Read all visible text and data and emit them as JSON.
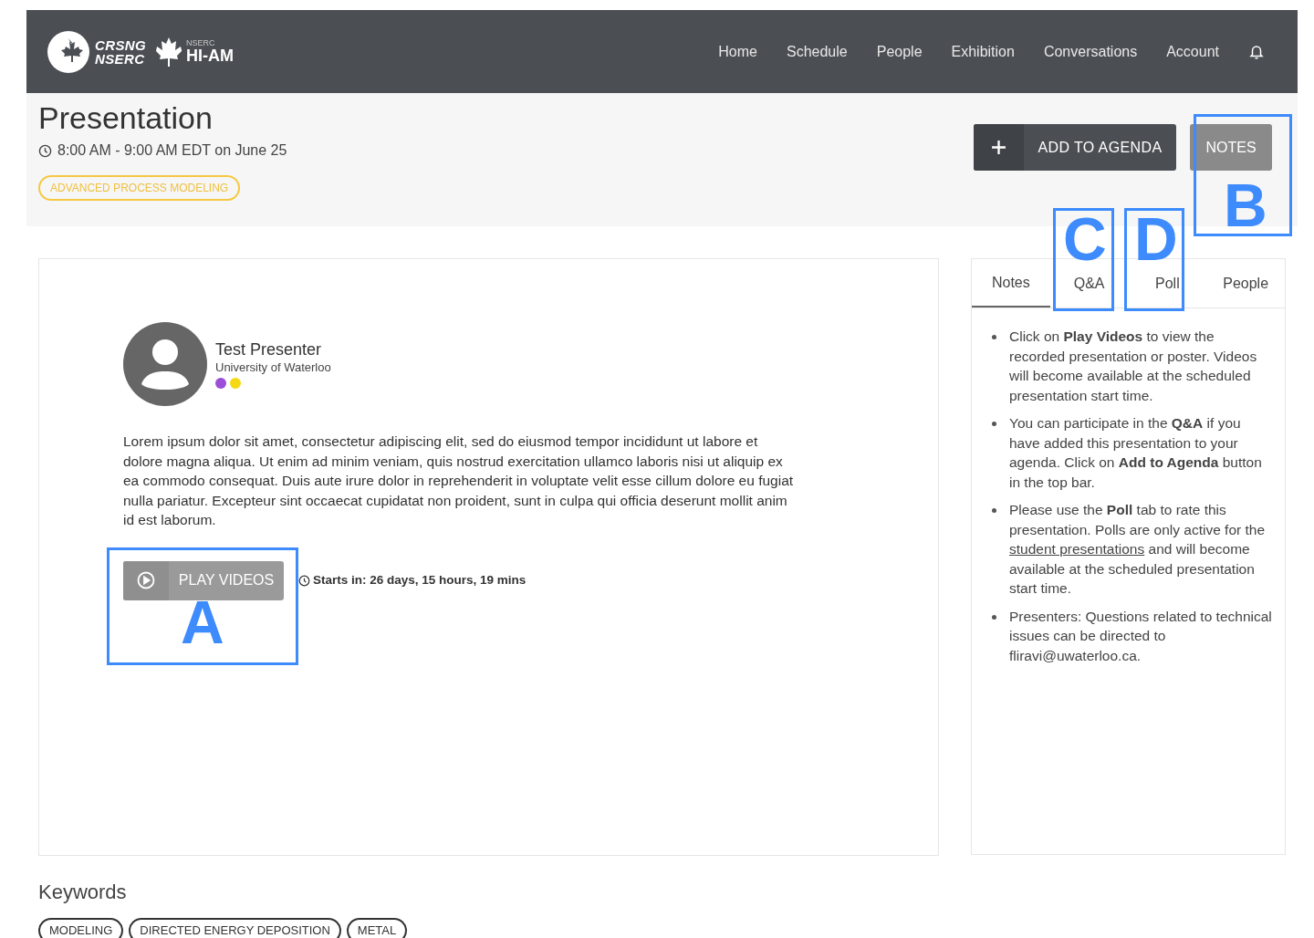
{
  "logo": {
    "org_top": "CRSNG",
    "org_bottom": "NSERC",
    "small": "NSERC",
    "name": "HI-AM"
  },
  "nav": [
    {
      "label": "Home"
    },
    {
      "label": "Schedule"
    },
    {
      "label": "People"
    },
    {
      "label": "Exhibition"
    },
    {
      "label": "Conversations"
    },
    {
      "label": "Account"
    }
  ],
  "page": {
    "title": "Presentation",
    "time": "8:00 AM - 9:00 AM EDT on June 25",
    "topic": "ADVANCED PROCESS MODELING",
    "add_button": "ADD TO AGENDA",
    "notes_button": "NOTES"
  },
  "presenter": {
    "name": "Test Presenter",
    "affiliation": "University of Waterloo",
    "dots": [
      {
        "color": "#9b4fd9"
      },
      {
        "color": "#f5d915"
      }
    ]
  },
  "description": "Lorem ipsum dolor sit amet, consectetur adipiscing elit, sed do eiusmod tempor incididunt ut labore et dolore magna aliqua. Ut enim ad minim veniam, quis nostrud exercitation ullamco laboris nisi ut aliquip ex ea commodo consequat. Duis aute irure dolor in reprehenderit in voluptate velit esse cillum dolore eu fugiat nulla pariatur. Excepteur sint occaecat cupidatat non proident, sunt in culpa qui officia deserunt mollit anim id est laborum.",
  "play_button": {
    "label": "PLAY VIDEOS",
    "disabled": true
  },
  "countdown": "Starts in: 26 days, 15 hours, 19 mins",
  "tabs": [
    {
      "label": "Notes",
      "selected": true
    },
    {
      "label": "Q&A",
      "selected": false
    },
    {
      "label": "Poll",
      "selected": false
    },
    {
      "label": "People",
      "selected": false
    }
  ],
  "notes": [
    {
      "parts": [
        {
          "kind": "text",
          "text": "Click on **Play Videos** to view the recorded presentation or poster. Videos will become available at the scheduled presentation start time."
        }
      ]
    },
    {
      "parts": [
        {
          "kind": "text",
          "text": "You can participate in the **Q&A** if you have added this presentation to your agenda. Click on **Add to Agenda** button in the top bar."
        }
      ]
    },
    {
      "parts": [
        {
          "kind": "text",
          "text": "Please use the **Poll** tab to rate this presentation. Polls are only active for the "
        },
        {
          "kind": "link",
          "text": "student presentations"
        },
        {
          "kind": "text",
          "text": " and will become available at the scheduled presentation start time."
        }
      ]
    },
    {
      "parts": [
        {
          "kind": "text",
          "text": "Presenters: Questions related to technical issues can be directed to fliravi@uwaterloo.ca."
        }
      ]
    }
  ],
  "keywords": {
    "title": "Keywords",
    "items": [
      "MODELING",
      "DIRECTED ENERGY DEPOSITION",
      "METAL"
    ]
  },
  "annotations": [
    {
      "label": "A"
    },
    {
      "label": "B"
    },
    {
      "label": "C"
    },
    {
      "label": "D"
    }
  ]
}
